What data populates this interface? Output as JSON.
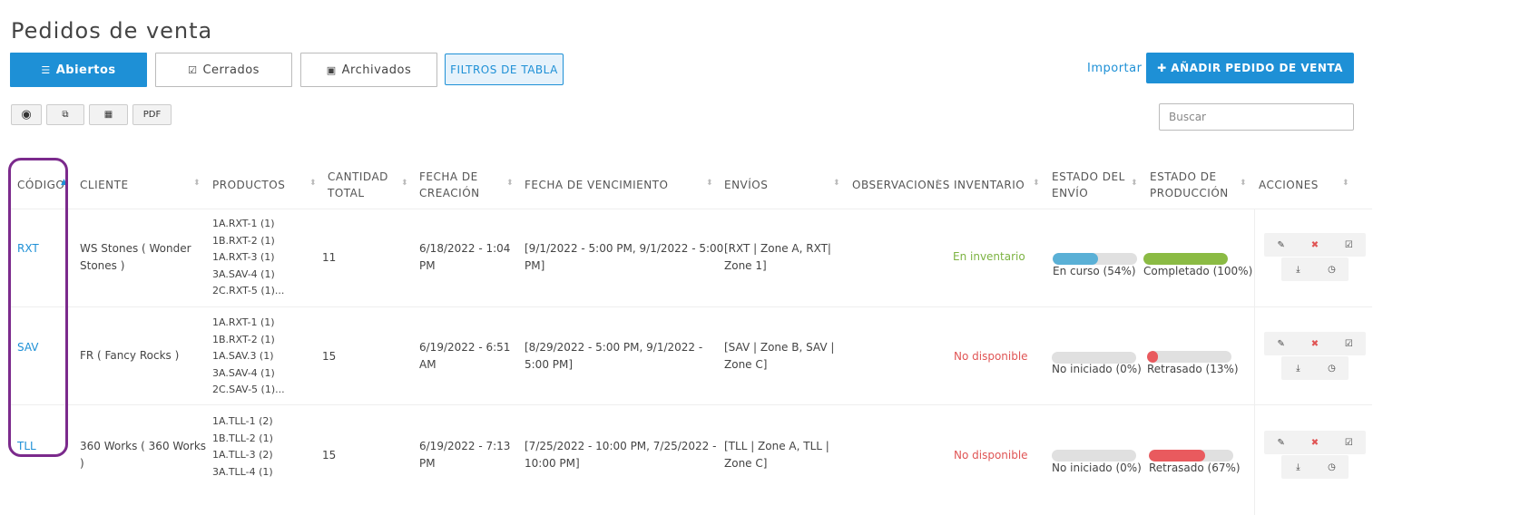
{
  "page": {
    "title": "Pedidos de venta"
  },
  "tabs": [
    {
      "label": "Abiertos",
      "icon": "list-icon",
      "active": true
    },
    {
      "label": "Cerrados",
      "icon": "check-square-icon",
      "active": false
    },
    {
      "label": "Archivados",
      "icon": "inbox-icon",
      "active": false
    }
  ],
  "filters_label": "FILTROS DE TABLA",
  "import_label": "Importar",
  "add_button_label": "AÑADIR PEDIDO DE VENTA",
  "toolbar": {
    "view_icon": "eye-icon",
    "copy_icon": "copy-icon",
    "table_icon": "table-icon",
    "pdf_label": "PDF"
  },
  "search": {
    "placeholder": "Buscar"
  },
  "colors": {
    "accent": "#1e90d6",
    "in_progress": "#5ab0d6",
    "completed": "#8bbb44",
    "delayed": "#e95a5e",
    "highlight": "#7b2a8c"
  },
  "columns": [
    {
      "line1": "CÓDIGO",
      "line2": ""
    },
    {
      "line1": "CLIENTE",
      "line2": ""
    },
    {
      "line1": "PRODUCTOS",
      "line2": ""
    },
    {
      "line1": "CANTIDAD",
      "line2": "TOTAL"
    },
    {
      "line1": "FECHA DE",
      "line2": "CREACIÓN"
    },
    {
      "line1": "FECHA DE VENCIMIENTO",
      "line2": ""
    },
    {
      "line1": "ENVÍOS",
      "line2": ""
    },
    {
      "line1": "OBSERVACIONES",
      "line2": ""
    },
    {
      "line1": "INVENTARIO",
      "line2": ""
    },
    {
      "line1": "ESTADO DEL",
      "line2": "ENVÍO"
    },
    {
      "line1": "ESTADO DE",
      "line2": "PRODUCCIÓN"
    },
    {
      "line1": "ACCIONES",
      "line2": ""
    }
  ],
  "rows": [
    {
      "code": "RXT",
      "client": [
        "WS Stones ( Wonder",
        "Stones )"
      ],
      "products": [
        "1A.RXT-1 (1)",
        "1B.RXT-2 (1)",
        "1A.RXT-3 (1)",
        "3A.SAV-4 (1)",
        "2C.RXT-5 (1)..."
      ],
      "quantity": "11",
      "created": [
        "6/18/2022 - 1:04",
        "PM"
      ],
      "due": [
        "[9/1/2022 - 5:00 PM, 9/1/2022 - 5:00",
        "PM]"
      ],
      "shipments": [
        "[RXT | Zone A, RXT|",
        "Zone 1]"
      ],
      "notes": "",
      "inventory": "En inventario",
      "inventory_ok": true,
      "shipping": {
        "label": "En curso (54%)",
        "progress": 0.54,
        "color": "#5ab0d6"
      },
      "production": {
        "label": "Completado (100%)",
        "progress": 1.0,
        "color": "#8bbb44"
      }
    },
    {
      "code": "SAV",
      "client": [
        "FR ( Fancy Rocks )"
      ],
      "products": [
        "1A.RXT-1 (1)",
        "1B.RXT-2 (1)",
        "1A.SAV.3 (1)",
        "3A.SAV-4 (1)",
        "2C.SAV-5 (1)..."
      ],
      "quantity": "15",
      "created": [
        "6/19/2022 - 6:51",
        "AM"
      ],
      "due": [
        "[8/29/2022 - 5:00 PM, 9/1/2022 -",
        "5:00 PM]"
      ],
      "shipments": [
        "[SAV | Zone B, SAV |",
        "Zone C]"
      ],
      "notes": "",
      "inventory": "No disponible",
      "inventory_ok": false,
      "shipping": {
        "label": "No iniciado (0%)",
        "progress": 0.0,
        "color": "#5ab0d6"
      },
      "production": {
        "label": "Retrasado (13%)",
        "progress": 0.13,
        "color": "#e95a5e"
      }
    },
    {
      "code": "TLL",
      "client": [
        "360 Works ( 360 Works",
        ")"
      ],
      "products": [
        "1A.TLL-1 (2)",
        "1B.TLL-2 (1)",
        "1A.TLL-3 (2)",
        "3A.TLL-4 (1)"
      ],
      "quantity": "15",
      "created": [
        "6/19/2022 - 7:13",
        "PM"
      ],
      "due": [
        "[7/25/2022 - 10:00 PM, 7/25/2022 -",
        "10:00 PM]"
      ],
      "shipments": [
        "[TLL | Zone A, TLL |",
        "Zone C]"
      ],
      "notes": "",
      "inventory": "No disponible",
      "inventory_ok": false,
      "shipping": {
        "label": "No iniciado (0%)",
        "progress": 0.0,
        "color": "#5ab0d6"
      },
      "production": {
        "label": "Retrasado (67%)",
        "progress": 0.67,
        "color": "#e95a5e"
      }
    }
  ],
  "row_actions": [
    "edit-icon",
    "trash-icon",
    "check-square-icon",
    "download-icon",
    "history-icon"
  ]
}
